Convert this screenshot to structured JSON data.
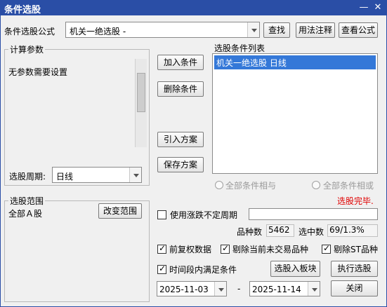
{
  "window": {
    "title": "条件选股",
    "minimize_glyph": "—",
    "close_glyph": "✕"
  },
  "formula": {
    "label": "条件选股公式",
    "value": "机关一绝选股  -",
    "find_button": "查找",
    "usage_button": "用法注释",
    "view_button": "查看公式"
  },
  "params": {
    "legend": "计算参数",
    "message": "无参数需要设置",
    "period_label": "选股周期:",
    "period_value": "日线"
  },
  "actions": {
    "add": "加入条件",
    "delete": "删除条件",
    "import": "引入方案",
    "save": "保存方案"
  },
  "conditions": {
    "legend": "选股条件列表",
    "items": [
      "机关一绝选股  日线"
    ],
    "radio_and": "全部条件相与",
    "radio_or": "全部条件相或"
  },
  "status": {
    "text": "选股完毕.",
    "color": "#e00000"
  },
  "range": {
    "legend": "选股范围",
    "value": "全部Ａ股",
    "change_button": "改变范围"
  },
  "uncertain_period": {
    "label": "使用涨跌不定周期",
    "checked": false,
    "value": ""
  },
  "stats": {
    "count_label": "品种数",
    "count_value": "5462",
    "selected_label": "选中数",
    "selected_value": "69/1.3%"
  },
  "options": {
    "forward_adjust": "前复权数据",
    "exclude_untraded": "剔除当前未交易品种",
    "exclude_st": "剔除ST品种",
    "time_range": "时间段内满足条件"
  },
  "dates": {
    "start": "2025-11-03",
    "separator": "-",
    "end": "2025-11-14"
  },
  "bottom_buttons": {
    "to_block": "选股入板块",
    "execute": "执行选股",
    "close": "关闭"
  },
  "colors": {
    "titlebar": "#2a4ea6",
    "selection": "#3478d8",
    "status_red": "#e00000"
  }
}
